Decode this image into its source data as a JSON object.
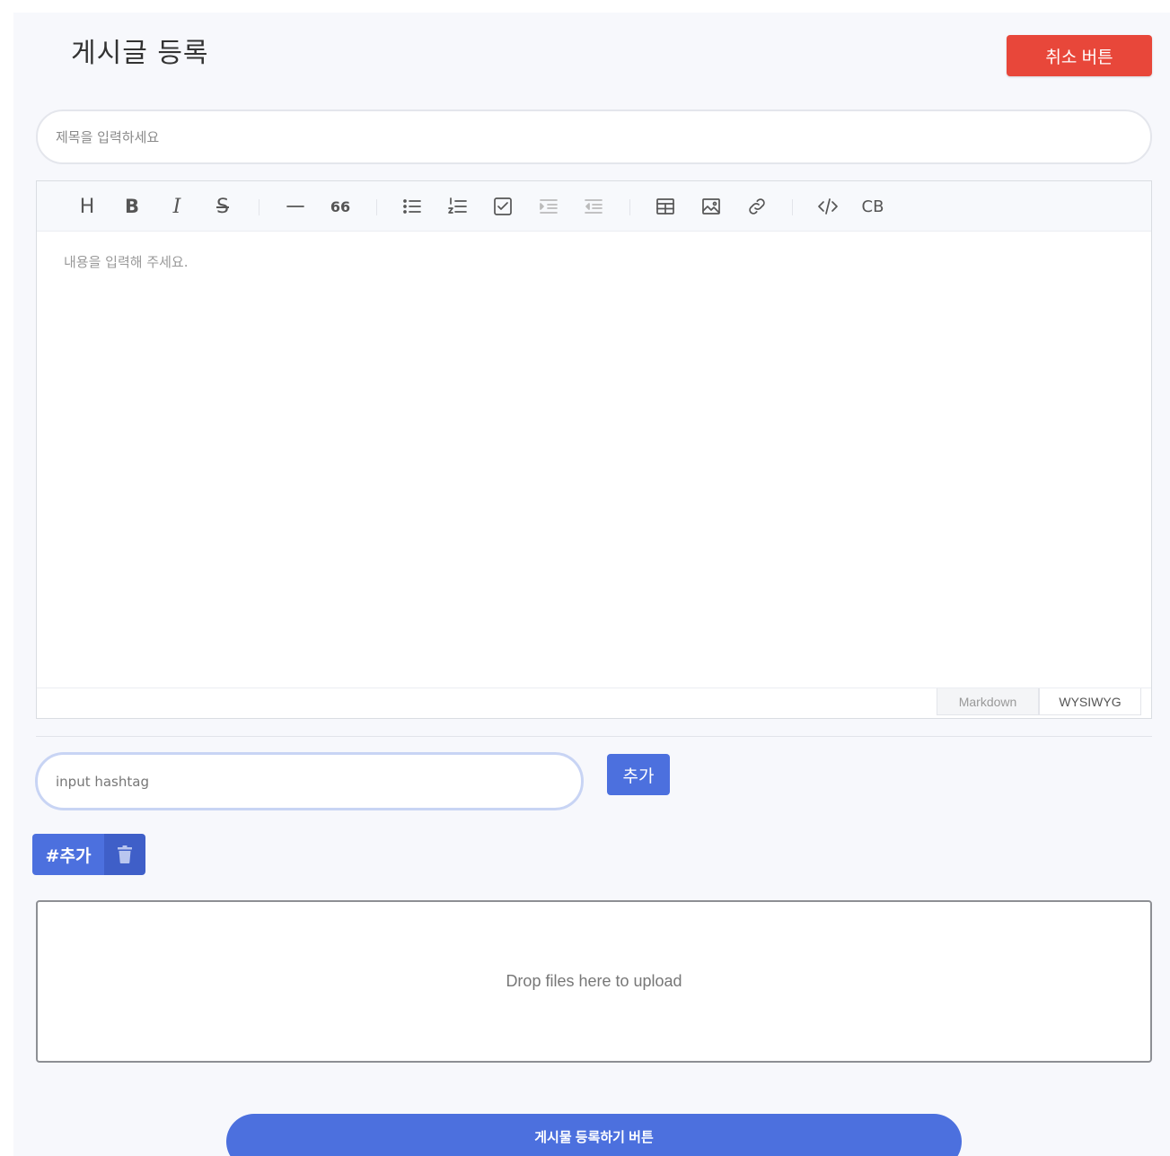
{
  "header": {
    "title": "게시글 등록",
    "cancel_label": "취소 버튼"
  },
  "title_field": {
    "placeholder": "제목을 입력하세요",
    "value": ""
  },
  "editor": {
    "toolbar": [
      {
        "name": "heading",
        "glyph": "H"
      },
      {
        "name": "bold",
        "glyph": "B"
      },
      {
        "name": "italic",
        "glyph": "I"
      },
      {
        "name": "strikethrough",
        "glyph": "S"
      },
      {
        "name": "horizontal-rule"
      },
      {
        "name": "quote",
        "glyph": "66"
      },
      {
        "name": "bullet-list"
      },
      {
        "name": "ordered-list"
      },
      {
        "name": "task-list"
      },
      {
        "name": "indent"
      },
      {
        "name": "outdent"
      },
      {
        "name": "table"
      },
      {
        "name": "image"
      },
      {
        "name": "link"
      },
      {
        "name": "code"
      },
      {
        "name": "code-block",
        "glyph": "CB"
      }
    ],
    "content_placeholder": "내용을 입력해 주세요.",
    "modes": {
      "markdown": "Markdown",
      "wysiwyg": "WYSIWYG",
      "active": "wysiwyg"
    }
  },
  "hashtag": {
    "placeholder": "input hashtag",
    "value": "",
    "add_label": "추가"
  },
  "tags": [
    {
      "label": "#추가"
    }
  ],
  "dropzone": {
    "text": "Drop files here to upload"
  },
  "submit": {
    "label": "게시물 등록하기 버튼"
  },
  "colors": {
    "cancel": "#e8473a",
    "primary": "#4c70de",
    "background": "#f7f8fc"
  }
}
